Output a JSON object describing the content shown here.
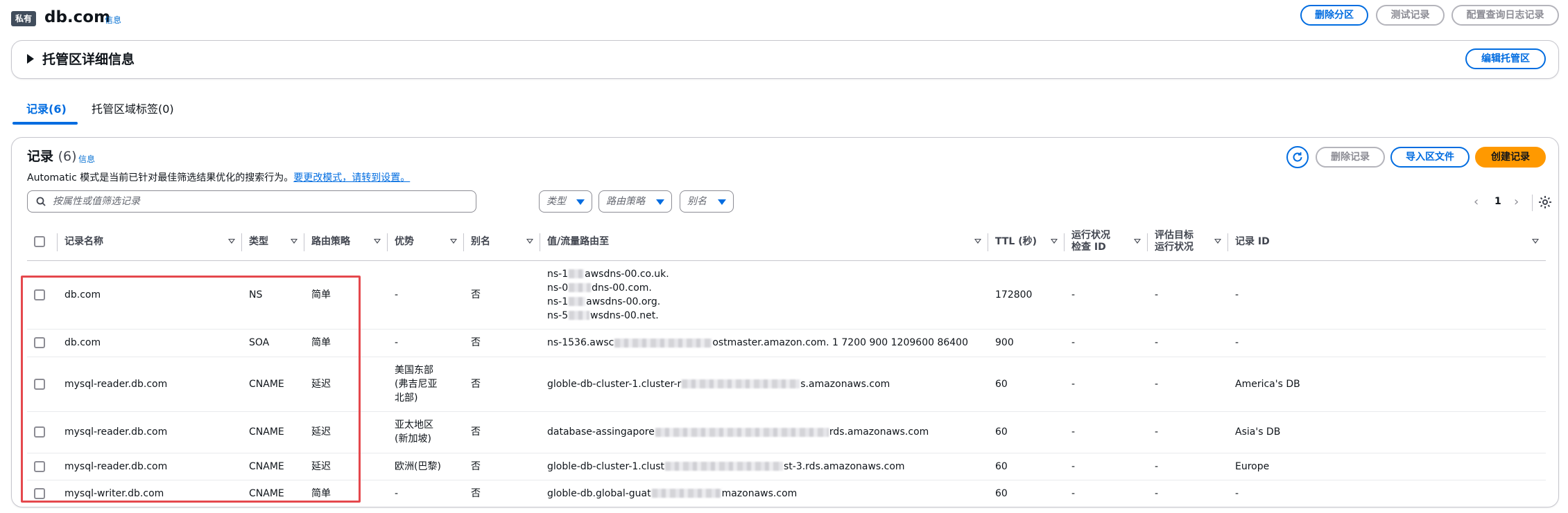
{
  "header": {
    "badge": "私有",
    "title": "db.com",
    "info": "信息",
    "buttons": {
      "delete_zone": "删除分区",
      "test_record": "测试记录",
      "query_log": "配置查询日志记录"
    }
  },
  "details": {
    "title": "托管区详细信息",
    "edit_button": "编辑托管区"
  },
  "tabs": [
    {
      "label": "记录(6)",
      "active": true
    },
    {
      "label": "托管区域标签(0)",
      "active": false
    }
  ],
  "records": {
    "title": "记录",
    "count": "(6)",
    "info": "信息",
    "desc": "Automatic 模式是当前已针对最佳筛选结果优化的搜索行为。",
    "desc_link": "要更改模式，请转到设置。",
    "buttons": {
      "delete": "删除记录",
      "import": "导入区文件",
      "create": "创建记录"
    },
    "search_placeholder": "按属性或值筛选记录",
    "filters": {
      "type": "类型",
      "policy": "路由策略",
      "alias": "别名"
    },
    "page": "1",
    "columns": {
      "name": "记录名称",
      "type": "类型",
      "policy": "路由策略",
      "priority": "优势",
      "alias": "别名",
      "value": "值/流量路由至",
      "ttl": "TTL (秒)",
      "health_1": "运行状况",
      "health_2": "检查 ID",
      "eval_1": "评估目标",
      "eval_2": "运行状况",
      "record_id": "记录 ID"
    },
    "rows": [
      {
        "name": "db.com",
        "type": "NS",
        "policy": "简单",
        "priority": "-",
        "alias": "否",
        "value_lines": [
          [
            "ns-1",
            "awsdns-00.co.uk."
          ],
          [
            "ns-0",
            "dns-00.com."
          ],
          [
            "ns-1",
            "awsdns-00.org."
          ],
          [
            "ns-5",
            "wsdns-00.net."
          ]
        ],
        "ttl": "172800",
        "health": "-",
        "eval": "-",
        "record_id": "-"
      },
      {
        "name": "db.com",
        "type": "SOA",
        "policy": "简单",
        "priority": "-",
        "alias": "否",
        "value_a": "ns-1536.awsc",
        "value_b": "ostmaster.amazon.com. 1 7200 900 1209600 86400",
        "ttl": "900",
        "health": "-",
        "eval": "-",
        "record_id": "-"
      },
      {
        "name": "mysql-reader.db.com",
        "type": "CNAME",
        "policy": "延迟",
        "priority_lines": [
          "美国东部",
          "(弗吉尼亚",
          "北部)"
        ],
        "alias": "否",
        "value_a": "globle-db-cluster-1.cluster-r",
        "value_b": "s.amazonaws.com",
        "ttl": "60",
        "health": "-",
        "eval": "-",
        "record_id": "America's DB"
      },
      {
        "name": "mysql-reader.db.com",
        "type": "CNAME",
        "policy": "延迟",
        "priority_lines": [
          "亚太地区",
          "(新加坡)"
        ],
        "alias": "否",
        "value_a": "database-assingapore",
        "value_b": "rds.amazonaws.com",
        "ttl": "60",
        "health": "-",
        "eval": "-",
        "record_id": "Asia's DB"
      },
      {
        "name": "mysql-reader.db.com",
        "type": "CNAME",
        "policy": "延迟",
        "priority": "欧洲(巴黎)",
        "alias": "否",
        "value_a": "globle-db-cluster-1.clust",
        "value_b": "st-3.rds.amazonaws.com",
        "ttl": "60",
        "health": "-",
        "eval": "-",
        "record_id": "Europe"
      },
      {
        "name": "mysql-writer.db.com",
        "type": "CNAME",
        "policy": "简单",
        "priority": "-",
        "alias": "否",
        "value_a": "globle-db.global-guat",
        "value_b": "mazonaws.com",
        "ttl": "60",
        "health": "-",
        "eval": "-",
        "record_id": "-"
      }
    ]
  },
  "colors": {
    "accent": "#006ce0",
    "primary_button": "#ff9900",
    "highlight": "#e5484d"
  }
}
